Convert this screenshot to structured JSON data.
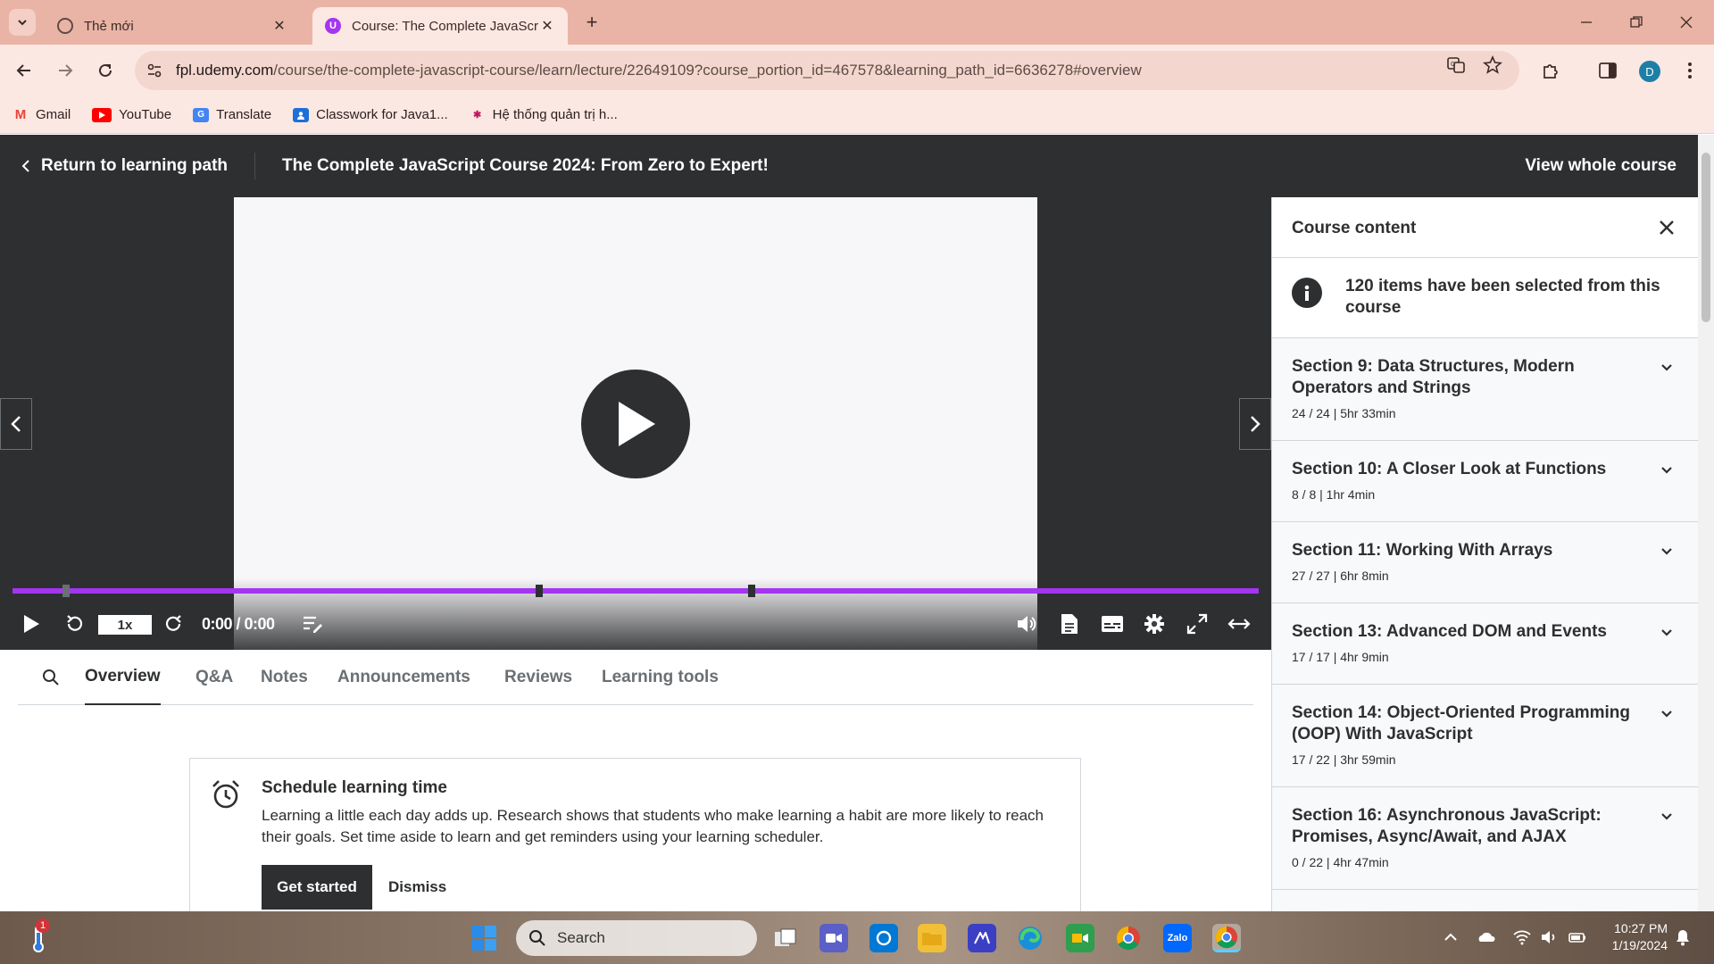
{
  "browser": {
    "tabs": [
      {
        "title": "Thẻ mới",
        "active": false
      },
      {
        "title": "Course: The Complete JavaScrip",
        "active": true
      }
    ],
    "url_host": "fpl.udemy.com",
    "url_path": "/course/the-complete-javascript-course/learn/lecture/22649109?course_portion_id=467578&learning_path_id=6636278#overview",
    "profile_initial": "D",
    "bookmarks": [
      {
        "label": "Gmail",
        "icon": "gmail-icon"
      },
      {
        "label": "YouTube",
        "icon": "youtube-icon"
      },
      {
        "label": "Translate",
        "icon": "translate-icon"
      },
      {
        "label": "Classwork for Java1...",
        "icon": "classroom-icon"
      },
      {
        "label": "Hệ thống quản trị h...",
        "icon": "system-icon"
      }
    ]
  },
  "header": {
    "return_label": "Return to learning path",
    "course_title": "The Complete JavaScript Course 2024: From Zero to Expert!",
    "view_whole_label": "View whole course"
  },
  "player": {
    "speed": "1x",
    "time": "0:00 / 0:00",
    "progress_markers": [
      0.04,
      0.42,
      0.59
    ]
  },
  "content_tabs": {
    "items": [
      "Overview",
      "Q&A",
      "Notes",
      "Announcements",
      "Reviews",
      "Learning tools"
    ],
    "active": "Overview"
  },
  "schedule": {
    "title": "Schedule learning time",
    "text": "Learning a little each day adds up. Research shows that students who make learning a habit are more likely to reach their goals. Set time aside to learn and get reminders using your learning scheduler.",
    "start_label": "Get started",
    "dismiss_label": "Dismiss"
  },
  "sidebar": {
    "title": "Course content",
    "info": "120 items have been selected from this course",
    "sections": [
      {
        "title": "Section 9: Data Structures, Modern Operators and Strings",
        "meta": "24 / 24 | 5hr 33min"
      },
      {
        "title": "Section 10: A Closer Look at Functions",
        "meta": "8 / 8 | 1hr 4min"
      },
      {
        "title": "Section 11: Working With Arrays",
        "meta": "27 / 27 | 6hr 8min"
      },
      {
        "title": "Section 13: Advanced DOM and Events",
        "meta": "17 / 17 | 4hr 9min"
      },
      {
        "title": "Section 14: Object-Oriented Programming (OOP) With JavaScript",
        "meta": "17 / 22 | 3hr 59min"
      },
      {
        "title": "Section 16: Asynchronous JavaScript: Promises, Async/Await, and AJAX",
        "meta": "0 / 22 | 4hr 47min"
      }
    ]
  },
  "taskbar": {
    "search_placeholder": "Search",
    "notification_count": "1",
    "time": "10:27 PM",
    "date": "1/19/2024",
    "zalo_label": "Zalo"
  },
  "colors": {
    "udemy_dark": "#2d2f31",
    "udemy_purple": "#a435f0",
    "chrome_tab": "#e9b4a6"
  }
}
